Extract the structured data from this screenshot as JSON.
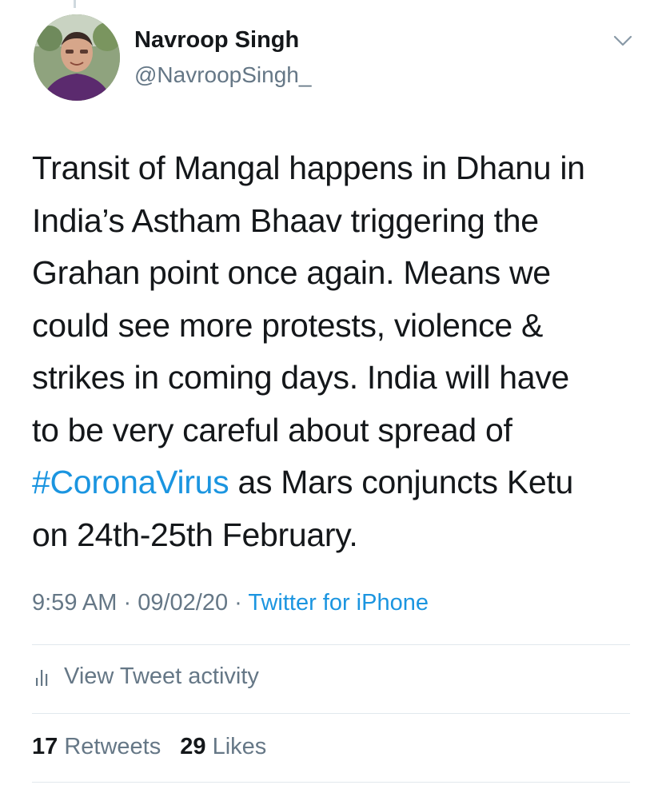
{
  "author": {
    "name": "Navroop Singh",
    "handle": "@NavroopSingh_"
  },
  "tweet": {
    "lines": [
      "Transit of Mangal happens in Dhanu in",
      "India’s Astham Bhaav triggering the",
      "Grahan point once again. Means we",
      "could see more protests, violence &",
      "strikes in coming days. India will have",
      "to be very careful about spread of"
    ],
    "hashtag": "#CoronaVirus",
    "line7_rest": " as Mars conjuncts Ketu",
    "line8": "on 24th-25th February."
  },
  "meta": {
    "time": "9:59 AM",
    "date": "09/02/20",
    "separator": " · ",
    "source": "Twitter for iPhone"
  },
  "activity": {
    "label": "View Tweet activity"
  },
  "stats": {
    "retweets_count": "17",
    "retweets_label": "Retweets",
    "likes_count": "29",
    "likes_label": "Likes"
  },
  "colors": {
    "link": "#1b95e0",
    "secondary": "#657786",
    "primary_text": "#14171a",
    "divider": "#e1e8ed"
  },
  "icons": [
    "chevron-down-icon",
    "bar-chart-icon"
  ]
}
